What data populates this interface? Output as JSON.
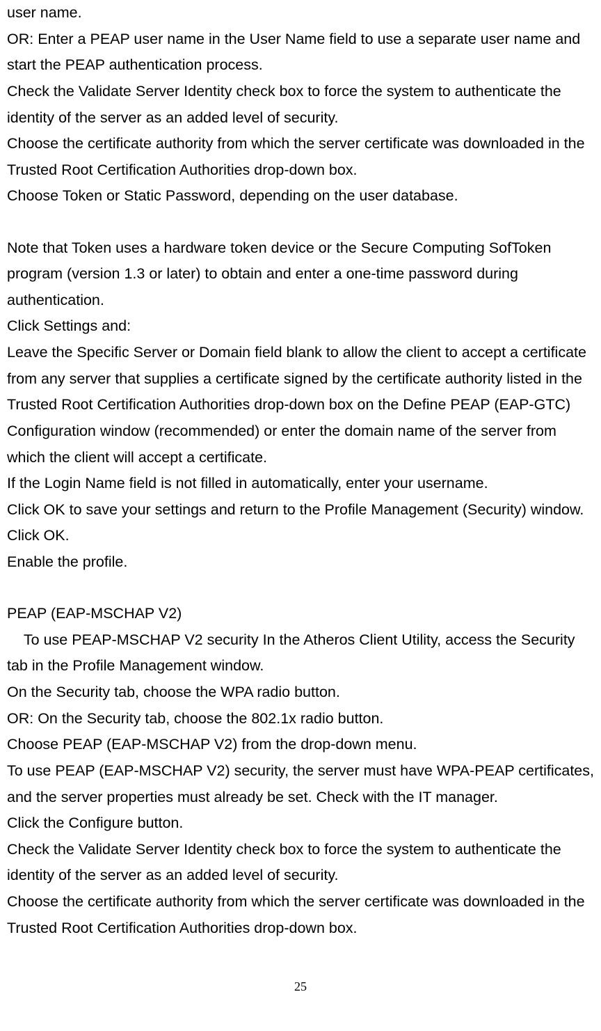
{
  "p1": "user name.",
  "p2": "OR: Enter a PEAP user name in the User Name field to use a separate user name and start the PEAP authentication process.",
  "p3": "Check the Validate Server Identity check box to force the system to authenticate the identity of the server as an added level of security.",
  "p4": "Choose the certificate authority from which the server certificate was downloaded in the Trusted Root Certification Authorities drop-down box.",
  "p5": "Choose Token or Static Password, depending on the user database.",
  "p6": "Note that Token uses a hardware token device or the Secure Computing SofToken program (version 1.3 or later) to obtain and enter a one-time password during authentication.",
  "p7": "Click Settings and:",
  "p8": "Leave the Specific Server or Domain field blank to allow the client to accept a certificate from any server that supplies a certificate signed by the certificate authority listed in the Trusted Root Certification Authorities drop-down box on the Define PEAP (EAP-GTC) Configuration window (recommended) or enter the domain name of the server from which the client will accept a certificate.",
  "p9": "If the Login Name field is not filled in automatically, enter your username.",
  "p10": "Click OK to save your settings and return to the Profile Management (Security) window.",
  "p11": "Click OK.",
  "p12": "Enable the profile.",
  "p13": "PEAP (EAP-MSCHAP V2)",
  "p14": "    To use PEAP-MSCHAP V2 security In the Atheros Client Utility, access the Security tab in the Profile Management window.",
  "p15": "On the Security tab, choose the WPA radio button.",
  "p16": "OR: On the Security tab, choose the 802.1x radio button.",
  "p17": "Choose PEAP (EAP-MSCHAP V2) from the drop-down menu.",
  "p18": "To use PEAP (EAP-MSCHAP V2) security, the server must have WPA-PEAP certificates, and the server properties must already be set. Check with the IT manager.",
  "p19": "Click the Configure button.",
  "p20": "Check the Validate Server Identity check box to force the system to authenticate the identity of the server as an added level of security.",
  "p21": "Choose the certificate authority from which the server certificate was downloaded in the Trusted Root Certification Authorities drop-down box.",
  "pageNumber": "25"
}
